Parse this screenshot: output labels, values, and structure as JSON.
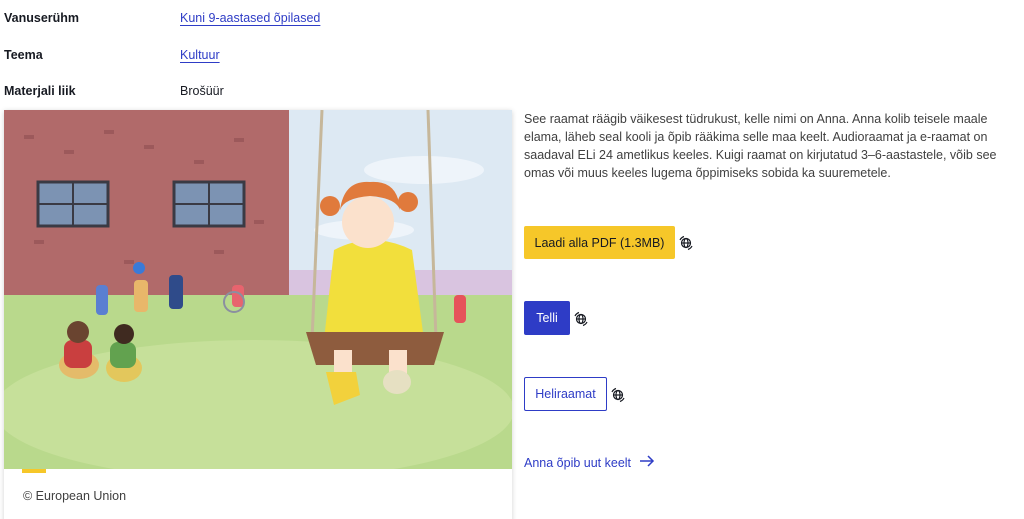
{
  "metadata": [
    {
      "key": "Vanuserühm",
      "value": "Kuni 9-aastased õpilased",
      "is_link": true
    },
    {
      "key": "Teema",
      "value": "Kultuur",
      "is_link": true
    },
    {
      "key": "Materjali liik",
      "value": "Brošüür",
      "is_link": false
    }
  ],
  "card": {
    "image_icon": "illustration-girl-on-swing",
    "caption": "© European Union"
  },
  "description": "See raamat räägib väikesest tüdrukust, kelle nimi on Anna. Anna kolib teisele maale elama, läheb seal kooli ja õpib rääkima selle maa keelt. Audioraamat ja e-raamat on saadaval ELi 24 ametlikus keeles. Kuigi raamat on kirjutatud 3–6-aastastele, võib see omas või muus keeles lugema õppimiseks sobida ka suuremetele.",
  "actions": {
    "download_label": "Laadi alla PDF (1.3MB)",
    "order_label": "Telli",
    "audiobook_label": "Heliraamat",
    "more_link_label": "Anna õpib uut keelt"
  },
  "colors": {
    "primary": "#2e3cc6",
    "accent_yellow": "#f6c729",
    "text": "#404040"
  }
}
